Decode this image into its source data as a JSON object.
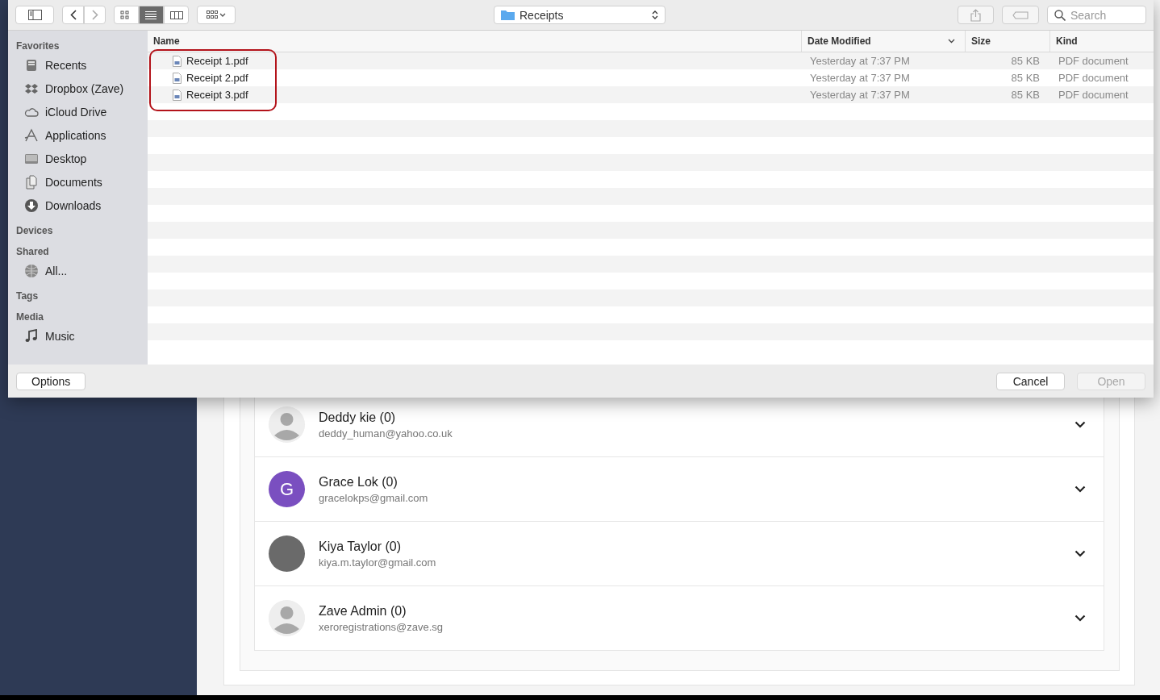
{
  "dialog": {
    "path": "Receipts",
    "view_modes": [
      {
        "selected": false
      },
      {
        "selected": true
      },
      {
        "selected": false
      }
    ],
    "search": {
      "placeholder": "Search"
    },
    "sidebar": [
      {
        "title": "Favorites",
        "items": [
          {
            "label": "Recents"
          },
          {
            "label": "Dropbox (Zave)"
          },
          {
            "label": "iCloud Drive"
          },
          {
            "label": "Applications"
          },
          {
            "label": "Desktop"
          },
          {
            "label": "Documents"
          },
          {
            "label": "Downloads"
          }
        ]
      },
      {
        "title": "Devices"
      },
      {
        "title": "Shared",
        "items": [
          {
            "label": "All..."
          }
        ]
      },
      {
        "title": "Tags"
      },
      {
        "title": "Media",
        "items": [
          {
            "label": "Music"
          }
        ]
      }
    ],
    "columns": [
      {
        "label": "Name",
        "sorted": false
      },
      {
        "label": "Date Modified",
        "sorted": true
      },
      {
        "label": "Size",
        "sorted": false
      },
      {
        "label": "Kind",
        "sorted": false
      }
    ],
    "files": [
      {
        "name": "Receipt 1.pdf",
        "date": "Yesterday at 7:37 PM",
        "size": "85 KB",
        "kind": "PDF document",
        "highlighted": true
      },
      {
        "name": "Receipt 2.pdf",
        "date": "Yesterday at 7:37 PM",
        "size": "85 KB",
        "kind": "PDF document",
        "highlighted": true
      },
      {
        "name": "Receipt 3.pdf",
        "date": "Yesterday at 7:37 PM",
        "size": "85 KB",
        "kind": "PDF document",
        "highlighted": true
      }
    ],
    "options_button": "Options",
    "buttons": [
      {
        "label": "Cancel",
        "disabled": false
      },
      {
        "label": "Open",
        "disabled": true
      }
    ]
  },
  "contacts": [
    {
      "name": "Deddy kie (0)",
      "email": "deddy_human@yahoo.co.uk",
      "avatar": {
        "kind": "placeholder"
      }
    },
    {
      "name": "Grace Lok (0)",
      "email": "gracelokps@gmail.com",
      "avatar": {
        "kind": "initial",
        "letter": "G",
        "color": "#7a4fc0"
      }
    },
    {
      "name": "Kiya Taylor (0)",
      "email": "kiya.m.taylor@gmail.com",
      "avatar": {
        "kind": "photo"
      }
    },
    {
      "name": "Zave Admin (0)",
      "email": "xeroregistrations@zave.sg",
      "avatar": {
        "kind": "placeholder"
      }
    }
  ]
}
